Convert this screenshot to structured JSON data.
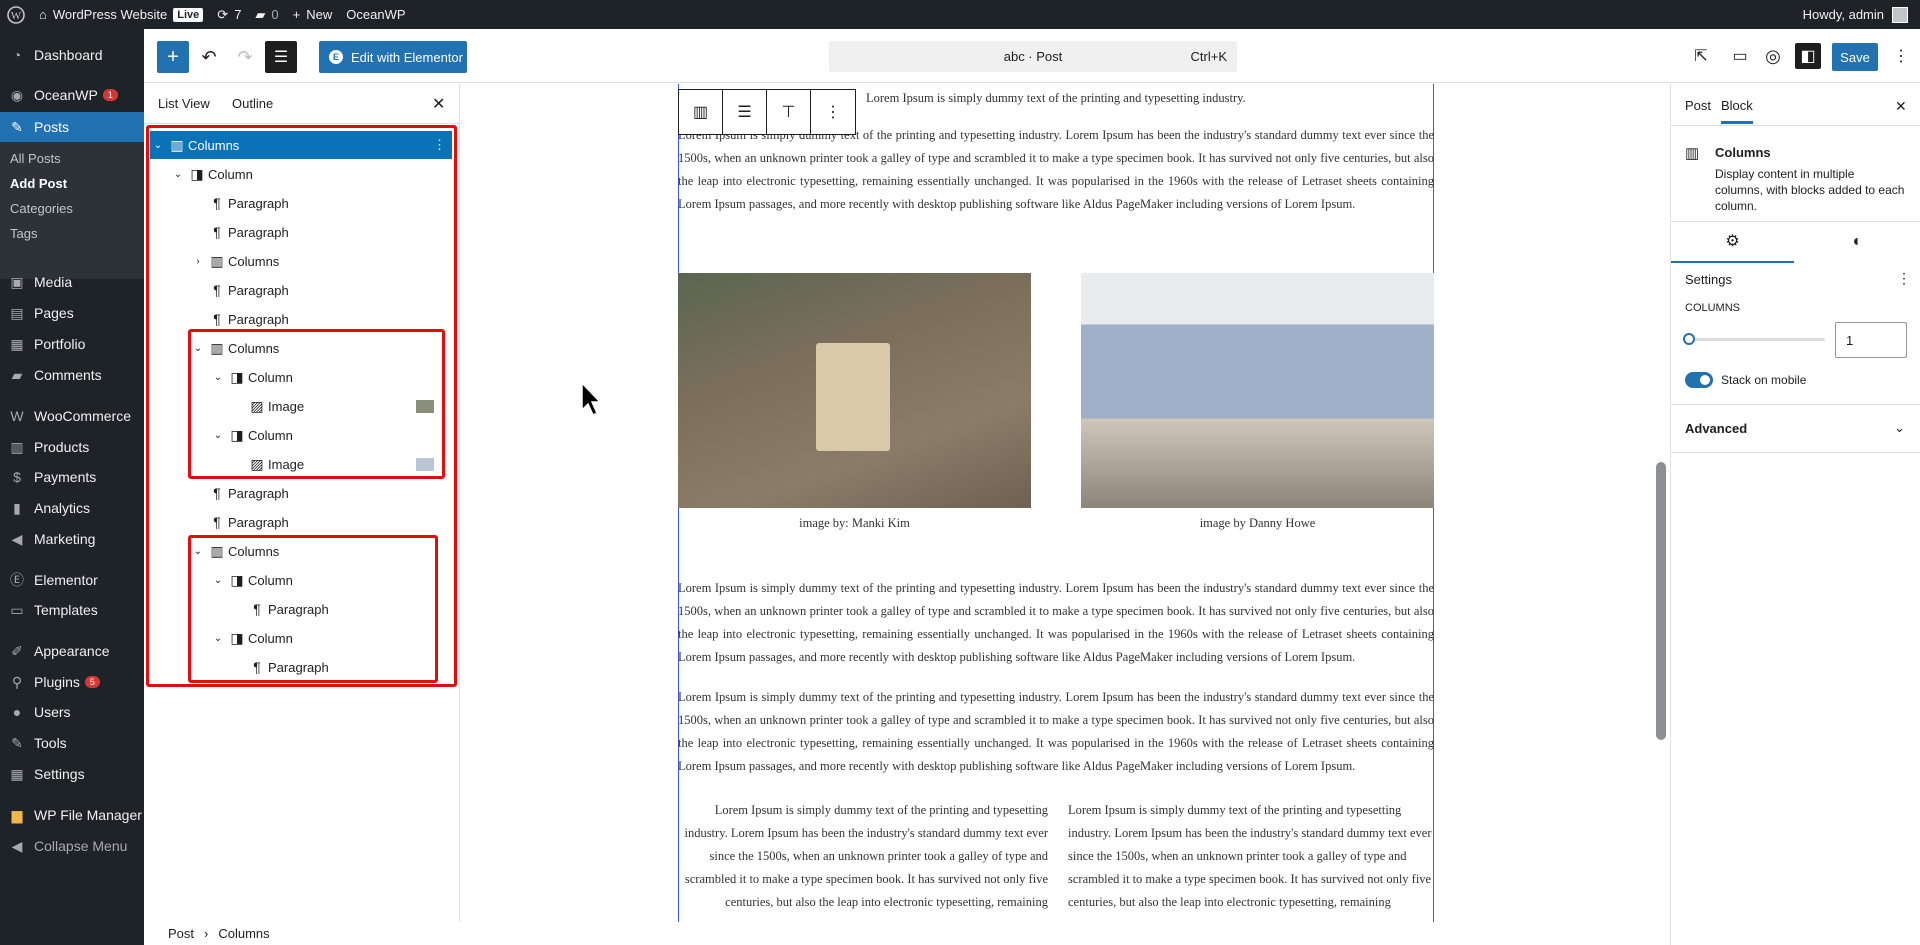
{
  "admin_bar": {
    "site": "WordPress Website",
    "live": "Live",
    "updates": "7",
    "comments": "0",
    "new": "New",
    "theme": "OceanWP",
    "howdy": "Howdy, admin"
  },
  "sidebar": {
    "items": [
      {
        "label": "Dashboard",
        "icon": "dashboard-icon"
      },
      {
        "label": "OceanWP",
        "badge": "1",
        "icon": "oceanwp-icon"
      },
      {
        "label": "Posts",
        "icon": "pin-icon"
      },
      {
        "label": "Media",
        "icon": "media-icon"
      },
      {
        "label": "Pages",
        "icon": "pages-icon"
      },
      {
        "label": "Portfolio",
        "icon": "portfolio-icon"
      },
      {
        "label": "Comments",
        "icon": "comments-icon"
      },
      {
        "label": "WooCommerce",
        "icon": "woo-icon"
      },
      {
        "label": "Products",
        "icon": "products-icon"
      },
      {
        "label": "Payments",
        "icon": "payments-icon"
      },
      {
        "label": "Analytics",
        "icon": "analytics-icon"
      },
      {
        "label": "Marketing",
        "icon": "marketing-icon"
      },
      {
        "label": "Elementor",
        "icon": "elementor-icon"
      },
      {
        "label": "Templates",
        "icon": "templates-icon"
      },
      {
        "label": "Appearance",
        "icon": "appearance-icon"
      },
      {
        "label": "Plugins",
        "badge": "5",
        "icon": "plugins-icon"
      },
      {
        "label": "Users",
        "icon": "users-icon"
      },
      {
        "label": "Tools",
        "icon": "tools-icon"
      },
      {
        "label": "Settings",
        "icon": "settings-icon"
      },
      {
        "label": "WP File Manager",
        "icon": "file-manager-icon"
      },
      {
        "label": "Collapse Menu",
        "icon": "collapse-icon"
      }
    ],
    "submenu": [
      "All Posts",
      "Add Post",
      "Categories",
      "Tags"
    ]
  },
  "header": {
    "edit_elementor": "Edit with Elementor",
    "command": "abc · Post",
    "shortcut": "Ctrl+K",
    "save": "Save"
  },
  "list_view": {
    "tabs": [
      "List View",
      "Outline"
    ],
    "rows": [
      "Columns",
      "Column",
      "Paragraph",
      "Paragraph",
      "Columns",
      "Paragraph",
      "Paragraph",
      "Columns",
      "Column",
      "Image",
      "Column",
      "Image",
      "Paragraph",
      "Paragraph",
      "Columns",
      "Column",
      "Paragraph",
      "Column",
      "Paragraph"
    ]
  },
  "breadcrumb": {
    "root": "Post",
    "current": "Columns"
  },
  "content": {
    "lead": "Lorem Ipsum is simply dummy text of the printing and typesetting industry.",
    "para": "Lorem Ipsum is simply dummy text of the printing and typesetting industry. Lorem Ipsum has been the industry's standard dummy text ever since the 1500s, when an unknown printer took a galley of type and scrambled it to make a type specimen book. It has survived not only five centuries, but also the leap into electronic typesetting, remaining essentially unchanged. It was popularised in the 1960s with the release of Letraset sheets containing Lorem Ipsum passages, and more recently with desktop publishing software like Aldus PageMaker including versions of Lorem Ipsum.",
    "caption1": "image by: Manki Kim",
    "caption2": "image by Danny Howe",
    "col_left": "Lorem Ipsum is simply dummy text of the printing and typesetting industry. Lorem Ipsum has been the industry's standard dummy text ever since the 1500s, when an unknown printer took a galley of type and scrambled it to make a type specimen book. It has survived not only five centuries, but also the leap into electronic typesetting, remaining",
    "col_right": "Lorem Ipsum is simply dummy text of the printing and typesetting industry. Lorem Ipsum has been the industry's standard dummy text ever since the 1500s, when an unknown printer took a galley of type and scrambled it to make a type specimen book. It has survived not only five centuries, but also the leap into electronic typesetting, remaining"
  },
  "settings_sidebar": {
    "tabs": [
      "Post",
      "Block"
    ],
    "block_name": "Columns",
    "block_desc": "Display content in multiple columns, with blocks added to each column.",
    "section": "Settings",
    "columns_label": "COLUMNS",
    "columns_value": "1",
    "stack_label": "Stack on mobile",
    "advanced": "Advanced"
  }
}
